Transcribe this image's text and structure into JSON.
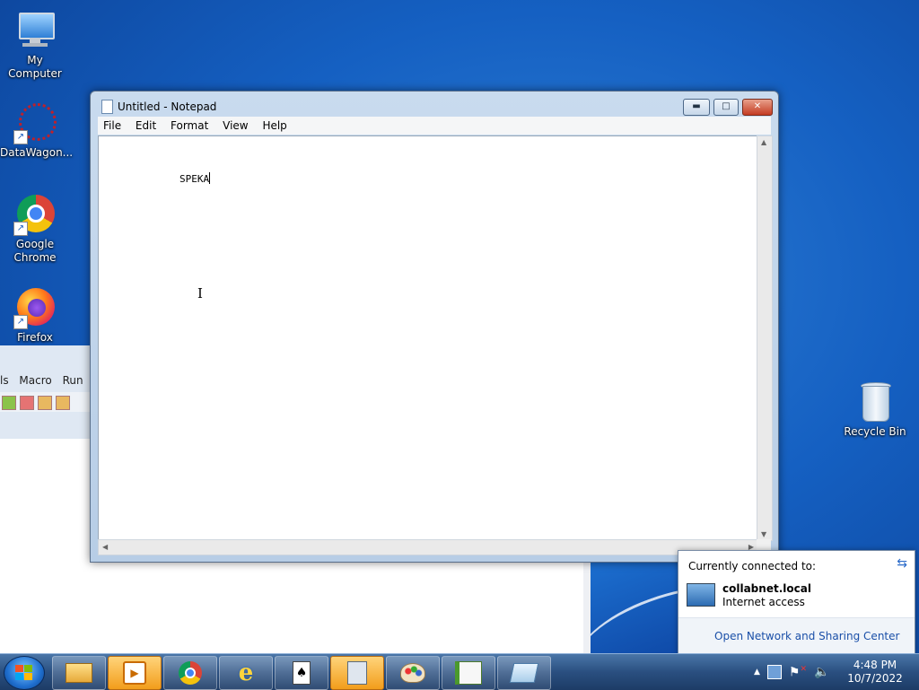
{
  "desktop": {
    "icons": [
      {
        "label": "My Computer",
        "icon": "computer-icon"
      },
      {
        "label": "DataWagon...",
        "icon": "datawagon-icon"
      },
      {
        "label": "Google Chrome",
        "icon": "chrome-icon"
      },
      {
        "label": "Firefox",
        "icon": "firefox-icon"
      },
      {
        "label": "Recycle Bin",
        "icon": "recycle-bin-icon"
      }
    ]
  },
  "background_window": {
    "menu": [
      "ls",
      "Macro",
      "Run"
    ]
  },
  "notepad": {
    "title": "Untitled - Notepad",
    "menu": [
      "File",
      "Edit",
      "Format",
      "View",
      "Help"
    ],
    "content": "SPEKA"
  },
  "network_popup": {
    "heading": "Currently connected to:",
    "network_name": "collabnet.local",
    "status": "Internet access",
    "link": "Open Network and Sharing Center"
  },
  "taskbar": {
    "pinned": [
      "windows-explorer-icon",
      "media-player-icon",
      "chrome-icon",
      "internet-explorer-icon",
      "solitaire-icon",
      "calculator-icon",
      "paint-icon",
      "macro-editor-icon",
      "notepad-icon"
    ],
    "time": "4:48 PM",
    "date": "10/7/2022"
  },
  "colors": {
    "desktop": "#1560c2",
    "taskbar": "#2a4f80",
    "link": "#1a4fa8"
  }
}
